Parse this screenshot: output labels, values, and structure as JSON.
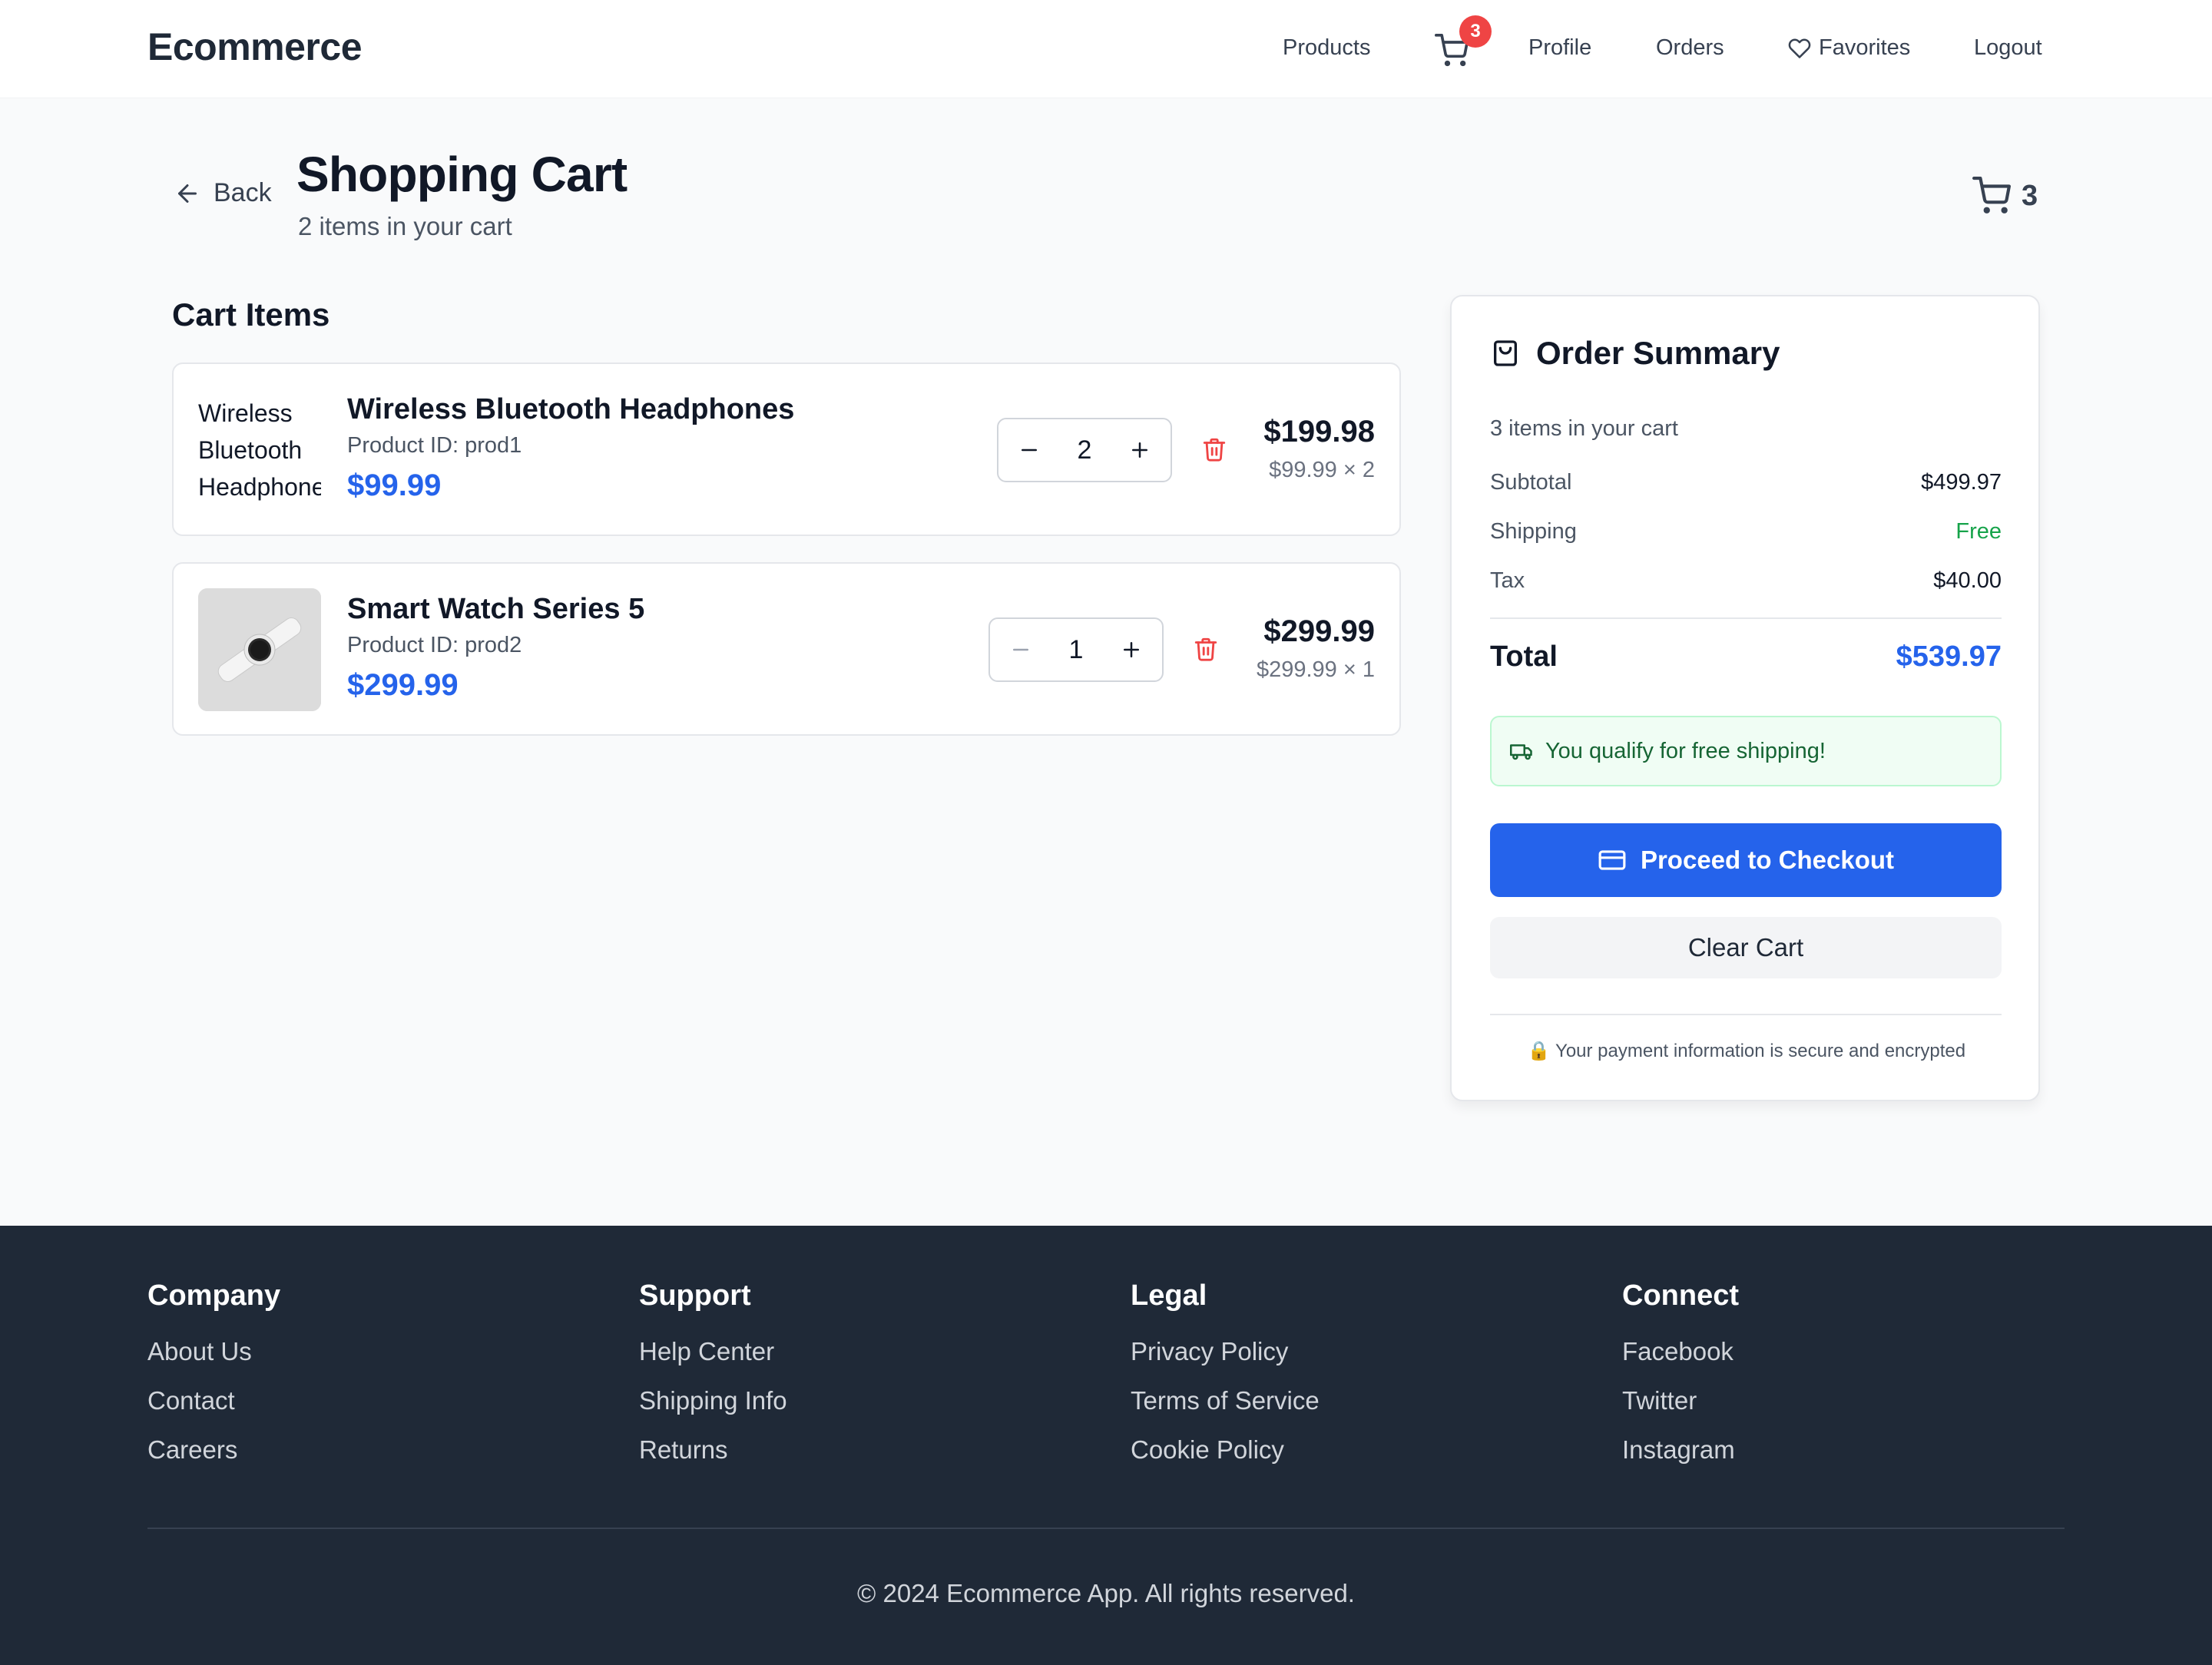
{
  "header": {
    "brand": "Ecommerce",
    "nav": {
      "products": "Products",
      "cart_badge": "3",
      "profile": "Profile",
      "orders": "Orders",
      "favorites": "Favorites",
      "logout": "Logout"
    }
  },
  "page": {
    "back_label": "Back",
    "title": "Shopping Cart",
    "subtitle": "2 items in your cart",
    "cart_count": "3"
  },
  "cart": {
    "section_title": "Cart Items",
    "items": [
      {
        "name": "Wireless Bluetooth Headphones",
        "image_alt": "Wireless Bluetooth Headphones",
        "product_id": "Product ID: prod1",
        "price": "$99.99",
        "quantity": "2",
        "line_total": "$199.98",
        "line_calc": "$99.99 × 2"
      },
      {
        "name": "Smart Watch Series 5",
        "image_alt": "Smart Watch Series 5",
        "product_id": "Product ID: prod2",
        "price": "$299.99",
        "quantity": "1",
        "line_total": "$299.99",
        "line_calc": "$299.99 × 1"
      }
    ]
  },
  "summary": {
    "title": "Order Summary",
    "count_text": "3 items in your cart",
    "subtotal_label": "Subtotal",
    "subtotal_value": "$499.97",
    "shipping_label": "Shipping",
    "shipping_value": "Free",
    "tax_label": "Tax",
    "tax_value": "$40.00",
    "total_label": "Total",
    "total_value": "$539.97",
    "free_shipping_note": "You qualify for free shipping!",
    "checkout_label": "Proceed to Checkout",
    "clear_label": "Clear Cart",
    "secure_note": "🔒 Your payment information is secure and encrypted",
    "colors": {
      "accent": "#2563eb",
      "success": "#16a34a",
      "danger": "#ef4444"
    }
  },
  "footer": {
    "columns": [
      {
        "heading": "Company",
        "links": [
          "About Us",
          "Contact",
          "Careers"
        ]
      },
      {
        "heading": "Support",
        "links": [
          "Help Center",
          "Shipping Info",
          "Returns"
        ]
      },
      {
        "heading": "Legal",
        "links": [
          "Privacy Policy",
          "Terms of Service",
          "Cookie Policy"
        ]
      },
      {
        "heading": "Connect",
        "links": [
          "Facebook",
          "Twitter",
          "Instagram"
        ]
      }
    ],
    "copyright": "© 2024 Ecommerce App. All rights reserved."
  },
  "icons": [
    "cart-icon",
    "heart-icon",
    "arrow-left-icon",
    "minus-icon",
    "plus-icon",
    "trash-icon",
    "shopping-bag-icon",
    "truck-icon",
    "credit-card-icon",
    "lock-icon"
  ]
}
